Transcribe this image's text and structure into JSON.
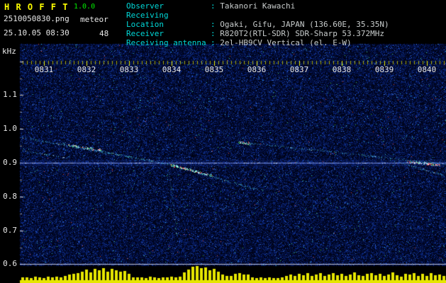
{
  "header": {
    "app_name": "H R O F F T",
    "version": "1.0.0",
    "filename": "2510050830.png",
    "mode": "meteor",
    "datetime": "25.10.05 08:30",
    "count": "48",
    "info": [
      {
        "label": "Observer",
        "value": "Takanori Kawachi"
      },
      {
        "label": "Receiving Location",
        "value": "Ogaki, Gifu, JAPAN (136.60E, 35.35N)"
      },
      {
        "label": "Receiver",
        "value": "R820T2(RTL-SDR) SDR-Sharp 53.372MHz"
      },
      {
        "label": "Receiving antenna",
        "value": "2el-HB9CV Vertical (el. E-W)"
      }
    ]
  },
  "colors": {
    "accent_yellow": "#ffff00",
    "version_green": "#00ee00",
    "label_cyan": "#00d8d8",
    "value_gray": "#c8cccc",
    "text_white": "#e8e8e8",
    "bar_yellow": "#e6e600",
    "trace_cyan": "#46bee6",
    "carrier_blue": "#8c9ce6",
    "noise_background": "#000316"
  },
  "chart_data": [
    {
      "type": "heatmap",
      "title": "HRO meteor echo spectrogram",
      "x_tick_labels": [
        "0831",
        "0832",
        "0833",
        "0834",
        "0835",
        "0836",
        "0837",
        "0838",
        "0839",
        "0840"
      ],
      "x_unit": "HHMM",
      "ylabel": "kHz",
      "y_ticks": [
        1.1,
        1.0,
        0.9,
        0.8,
        0.7,
        0.6
      ],
      "y_tick_labels": [
        "1.1",
        "1.0",
        "0.9",
        "0.8",
        "0.7",
        "0.6"
      ],
      "y_range": [
        0.6,
        1.2
      ],
      "carrier_line_khz": 0.9,
      "marker_line_khz": 0.6,
      "traces": [
        {
          "m1": 0.47,
          "f1": 0.976,
          "m2": 2.77,
          "f2": 0.922,
          "strength": 0.55
        },
        {
          "m1": 0.47,
          "f1": 0.937,
          "m2": 1.55,
          "f2": 0.914,
          "strength": 0.35
        },
        {
          "m1": 1.43,
          "f1": 0.957,
          "m2": 3.93,
          "f2": 0.896,
          "strength": 0.7
        },
        {
          "m1": 3.93,
          "f1": 0.896,
          "m2": 6.0,
          "f2": 0.822,
          "strength": 0.7
        },
        {
          "m1": 3.92,
          "f1": 0.888,
          "m2": 4.13,
          "f2": 0.673,
          "strength": 0.22
        },
        {
          "m1": 5.6,
          "f1": 0.961,
          "m2": 7.77,
          "f2": 0.933,
          "strength": 0.5
        },
        {
          "m1": 7.77,
          "f1": 0.933,
          "m2": 10.45,
          "f2": 0.896,
          "strength": 0.55
        },
        {
          "m1": 9.23,
          "f1": 0.906,
          "m2": 10.45,
          "f2": 0.861,
          "strength": 0.5
        }
      ],
      "echo_clusters": [
        {
          "m1": 1.55,
          "f1": 0.953,
          "m2": 2.35,
          "f2": 0.938,
          "dots": 80
        },
        {
          "m1": 3.97,
          "f1": 0.894,
          "m2": 4.97,
          "f2": 0.862,
          "dots": 170
        },
        {
          "m1": 5.55,
          "f1": 0.962,
          "m2": 5.85,
          "f2": 0.957,
          "dots": 40
        },
        {
          "m1": 9.55,
          "f1": 0.903,
          "m2": 10.3,
          "f2": 0.894,
          "dots": 110
        }
      ]
    },
    {
      "type": "bar",
      "title": "Signal level vs time",
      "color_key": "bar_yellow",
      "values": [
        0.18,
        0.22,
        0.15,
        0.25,
        0.2,
        0.17,
        0.23,
        0.19,
        0.26,
        0.21,
        0.3,
        0.38,
        0.45,
        0.52,
        0.6,
        0.75,
        0.55,
        0.8,
        0.68,
        0.85,
        0.62,
        0.78,
        0.7,
        0.58,
        0.65,
        0.45,
        0.22,
        0.18,
        0.2,
        0.16,
        0.24,
        0.19,
        0.17,
        0.21,
        0.18,
        0.23,
        0.2,
        0.25,
        0.55,
        0.75,
        0.95,
        1.0,
        0.85,
        0.9,
        0.7,
        0.8,
        0.6,
        0.4,
        0.3,
        0.28,
        0.45,
        0.5,
        0.42,
        0.38,
        0.2,
        0.16,
        0.18,
        0.15,
        0.19,
        0.17,
        0.16,
        0.18,
        0.3,
        0.42,
        0.28,
        0.45,
        0.35,
        0.5,
        0.32,
        0.4,
        0.48,
        0.3,
        0.38,
        0.52,
        0.34,
        0.46,
        0.28,
        0.42,
        0.55,
        0.36,
        0.3,
        0.44,
        0.5,
        0.33,
        0.47,
        0.29,
        0.41,
        0.53,
        0.35,
        0.27,
        0.45,
        0.38,
        0.51,
        0.32,
        0.43,
        0.29,
        0.48,
        0.36,
        0.4,
        0.31
      ]
    }
  ]
}
